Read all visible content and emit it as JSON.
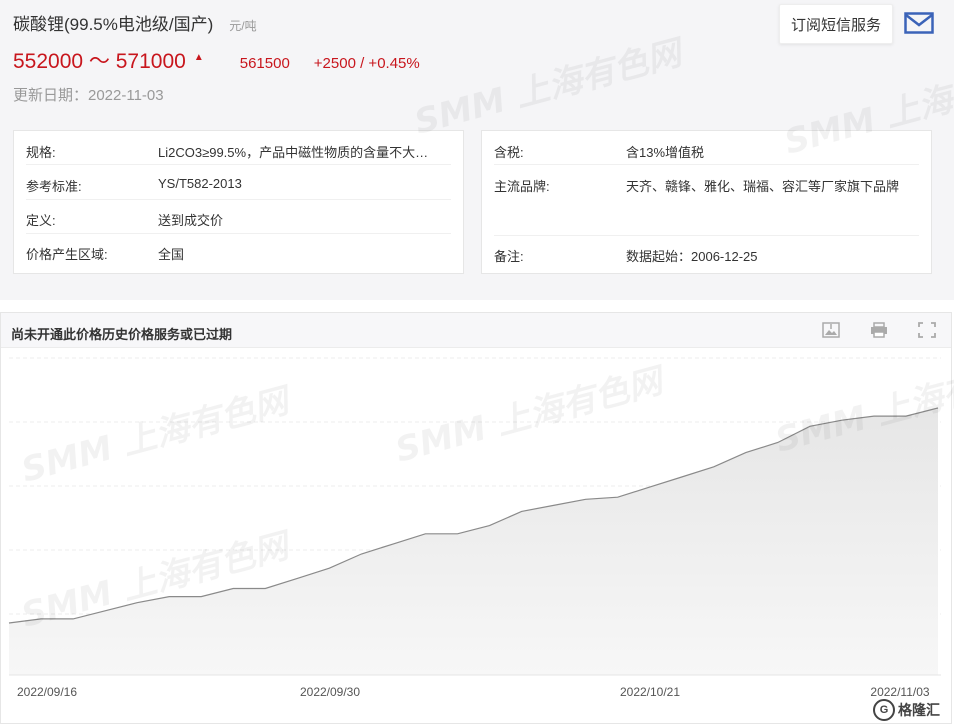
{
  "header": {
    "title": "碳酸锂(99.5%电池级/国产)",
    "unit": "元/吨",
    "price_range": "552000 ～ 571000",
    "average": "561500",
    "change": "+2500 / +0.45%",
    "update_date": "更新日期：2022-11-03",
    "subscribe_label": "订阅短信服务",
    "accent_color": "#c8161d"
  },
  "info_left": [
    {
      "key": "规格:",
      "value": "Li2CO3≥99.5%，产品中磁性物质的含量不大…"
    },
    {
      "key": "参考标准:",
      "value": "YS/T582-2013"
    },
    {
      "key": "定义:",
      "value": "送到成交价"
    },
    {
      "key": "价格产生区域:",
      "value": "全国"
    }
  ],
  "info_right": [
    {
      "key": "含税:",
      "value": "含13%增值税"
    },
    {
      "key": "主流品牌:",
      "value": "天齐、赣锋、雅化、瑞福、容汇等厂家旗下品牌"
    },
    {
      "key": "备注:",
      "value": "数据起始：2006-12-25"
    }
  ],
  "chart_panel": {
    "title": "尚未开通此价格历史价格服务或已过期",
    "toolbar": [
      "download-image-icon",
      "print-icon",
      "fullscreen-icon"
    ]
  },
  "chart_data": {
    "type": "area",
    "x_tick_labels": [
      "2022/09/16",
      "2022/09/30",
      "2022/10/21",
      "2022/11/03"
    ],
    "series": [
      {
        "values": [
          0,
          2,
          2,
          6,
          10,
          13,
          13,
          17,
          17,
          22,
          27,
          34,
          39,
          44,
          44,
          48,
          55,
          58,
          61,
          62,
          67,
          72,
          77,
          84,
          89,
          97,
          100,
          102,
          102,
          106
        ]
      }
    ],
    "line_color": "#8a8a8a",
    "fill_color": "#e6e6e6",
    "grid": true
  },
  "watermark": "SMM 上海有色网",
  "corner_logo": "格隆汇"
}
